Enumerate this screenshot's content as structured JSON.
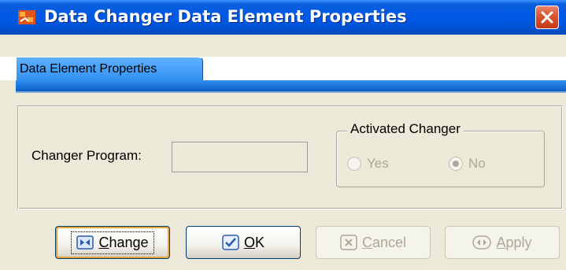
{
  "window": {
    "title": "Data Changer Data Element Properties",
    "app_icon": "app-icon",
    "close_icon": "close-icon"
  },
  "tabs": [
    {
      "label": "Data Element Properties",
      "selected": true
    }
  ],
  "form": {
    "changer_program_label": "Changer Program:",
    "changer_program_value": "",
    "activated_changer": {
      "legend": "Activated Changer",
      "options": [
        {
          "label": "Yes",
          "checked": false,
          "enabled": false
        },
        {
          "label": "No",
          "checked": true,
          "enabled": false
        }
      ]
    }
  },
  "buttons": {
    "change": {
      "mnemonic": "C",
      "rest": "hange",
      "icon": "change-icon",
      "enabled": true,
      "focused": true
    },
    "ok": {
      "mnemonic": "O",
      "rest": "K",
      "icon": "check-icon",
      "enabled": true
    },
    "cancel": {
      "mnemonic": "C",
      "rest": "ancel",
      "icon": "x-icon",
      "enabled": false
    },
    "apply": {
      "mnemonic": "A",
      "rest": "pply",
      "icon": "apply-icon",
      "enabled": false
    }
  },
  "colors": {
    "title_bar": "#0058E6",
    "dialog_bg": "#ECE9D8",
    "tab_blue": "#2F8FF0",
    "close_red": "#D9532F",
    "disabled_text": "#ACA899"
  }
}
